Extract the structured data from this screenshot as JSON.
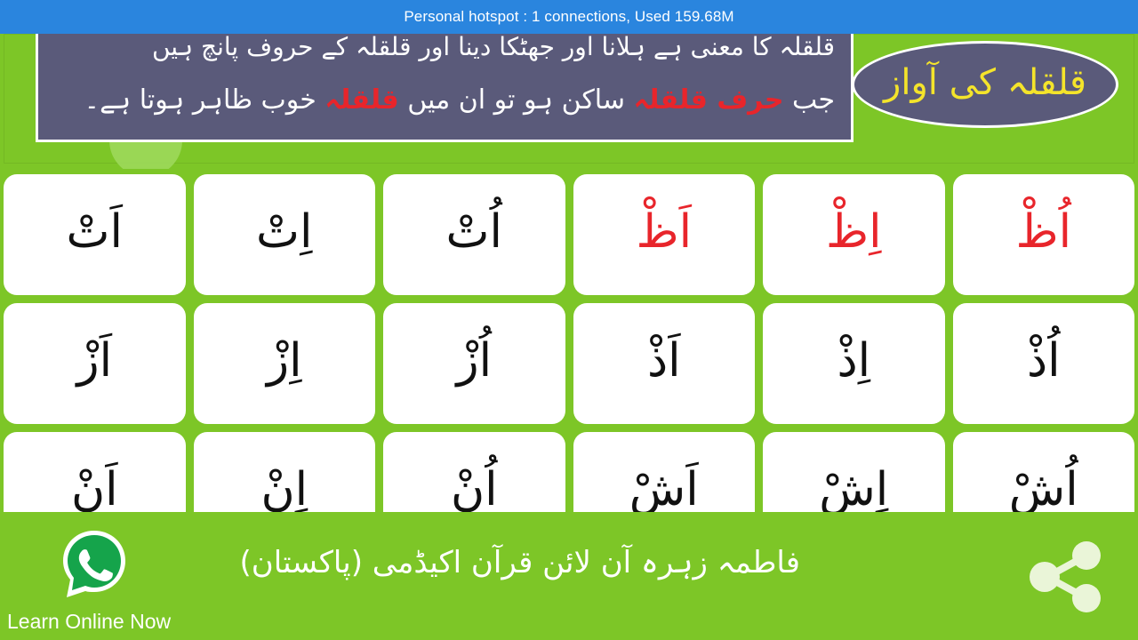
{
  "statusbar": {
    "text": "Personal hotspot : 1 connections, Used 159.68M",
    "background": "#2A85DE"
  },
  "theme": {
    "green": "#7DC627",
    "card": "#FFFFFF",
    "banner": "#5A5A7A",
    "title_yellow": "#F4E42B",
    "accent_red": "#E8252B",
    "sukun_blue": "#29A8E0"
  },
  "banner": {
    "title": "قلقلہ کی آواز",
    "note_line_1": "قلقلہ کا معنی ہے ہلانا اور جھٹکا دینا اور قلقلہ کے حروف پانچ ہیں",
    "note_line_2_prefix": "جب ",
    "note_line_2_red": "حرف قلقلہ",
    "note_line_2_mid": " ساکن ہو تو ان میں ",
    "note_line_2_red2": "قلقلہ",
    "note_line_2_suffix": " خوب ظاہر ہوتا ہے۔"
  },
  "grid": {
    "rows": [
      [
        {
          "glyph": "اُظْ",
          "color": "red"
        },
        {
          "glyph": "اِظْ",
          "color": "red"
        },
        {
          "glyph": "اَظْ",
          "color": "red"
        },
        {
          "glyph": "اُتْ",
          "color": "black"
        },
        {
          "glyph": "اِتْ",
          "color": "black"
        },
        {
          "glyph": "اَتْ",
          "color": "black"
        }
      ],
      [
        {
          "glyph": "اُذْ",
          "color": "black"
        },
        {
          "glyph": "اِذْ",
          "color": "black"
        },
        {
          "glyph": "اَذْ",
          "color": "black"
        },
        {
          "glyph": "اُزْ",
          "color": "black"
        },
        {
          "glyph": "اِزْ",
          "color": "black"
        },
        {
          "glyph": "اَزْ",
          "color": "black"
        }
      ],
      [
        {
          "glyph": "اُشْ",
          "color": "black"
        },
        {
          "glyph": "اِشْ",
          "color": "black"
        },
        {
          "glyph": "اَشْ",
          "color": "black"
        },
        {
          "glyph": "اُنْ",
          "color": "black"
        },
        {
          "glyph": "اِنْ",
          "color": "black"
        },
        {
          "glyph": "اَنْ",
          "color": "black"
        }
      ]
    ]
  },
  "footer": {
    "whatsapp_label": "Learn Online Now",
    "academy_name": "فاطمہ زہرہ آن لائن قرآن اکیڈمی (پاکستان)",
    "whatsapp_icon": "whatsapp-icon",
    "share_icon": "share-icon"
  }
}
